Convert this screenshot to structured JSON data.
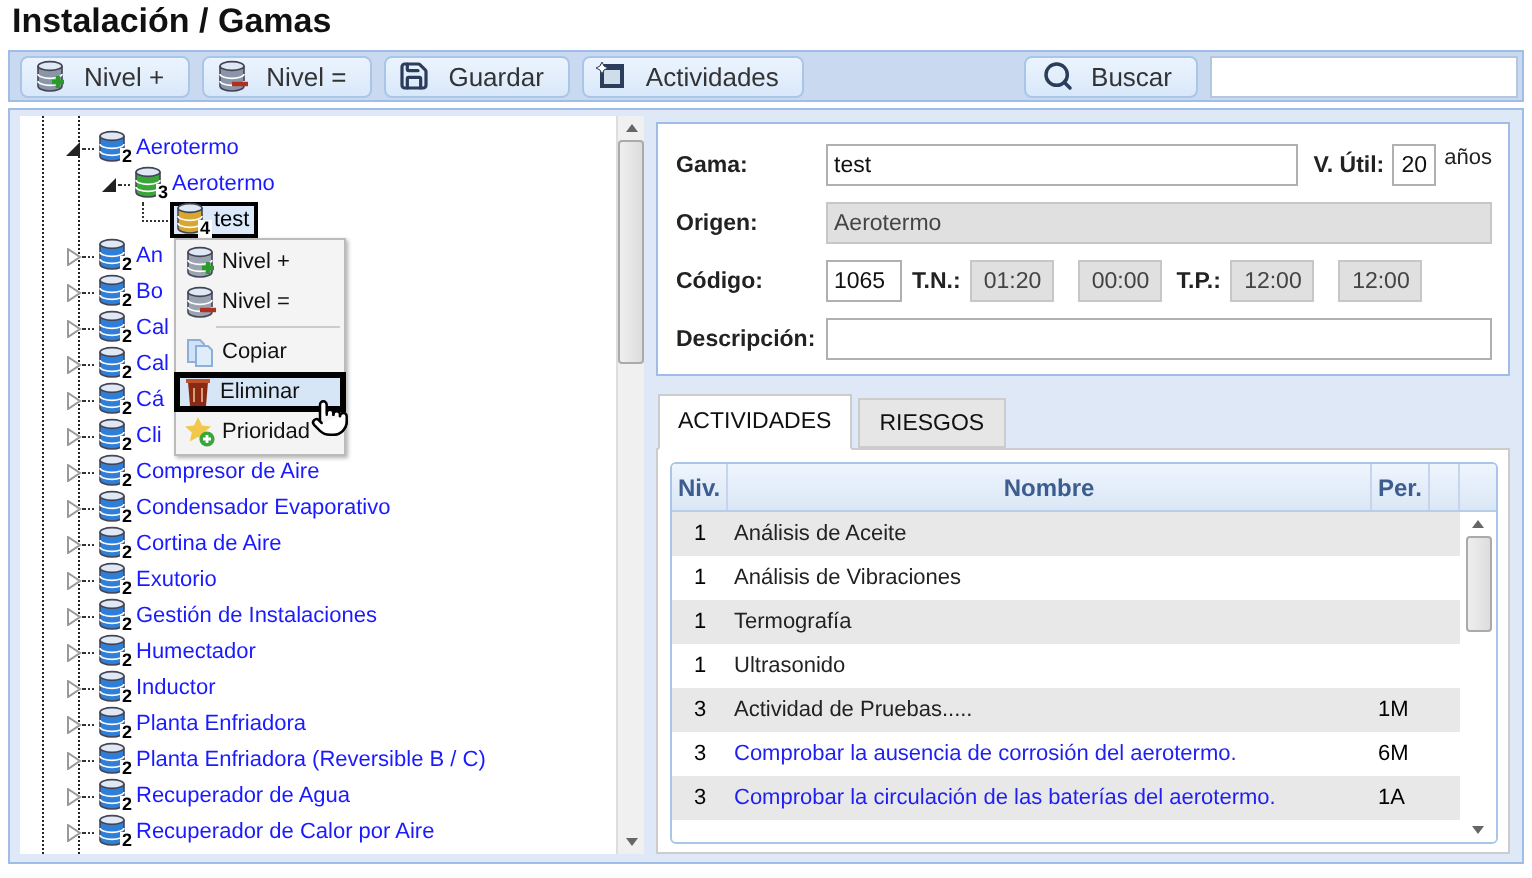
{
  "page_title": "Instalación / Gamas",
  "toolbar": {
    "buttons": [
      {
        "kind": "level-add",
        "label": "Nivel +"
      },
      {
        "kind": "level-equal",
        "label": "Nivel ="
      },
      {
        "kind": "save",
        "label": "Guardar"
      },
      {
        "kind": "activities",
        "label": "Actividades"
      }
    ],
    "search_button": "Buscar"
  },
  "tree": {
    "items": [
      {
        "label": "Aerotermo",
        "badge": "2",
        "color": "#2f7fd8",
        "expanded": true,
        "selected": false,
        "children": [
          {
            "label": "Aerotermo",
            "badge": "3",
            "color": "#3aa63a",
            "expanded": true,
            "selected": false,
            "children": [
              {
                "label": "test",
                "badge": "4",
                "color": "#d9a630",
                "selected": true
              }
            ]
          }
        ]
      },
      {
        "label": "An",
        "badge": "2",
        "color": "#2f7fd8",
        "expanded": false,
        "selected": false
      },
      {
        "label": "Bo",
        "badge": "2",
        "color": "#2f7fd8",
        "expanded": false,
        "selected": false
      },
      {
        "label": "Cal",
        "badge": "2",
        "color": "#2f7fd8",
        "expanded": false,
        "selected": false
      },
      {
        "label": "Cal",
        "badge": "2",
        "color": "#2f7fd8",
        "expanded": false,
        "selected": false
      },
      {
        "label": "Cá",
        "badge": "2",
        "color": "#2f7fd8",
        "expanded": false,
        "selected": false
      },
      {
        "label": "Cli",
        "badge": "2",
        "color": "#2f7fd8",
        "expanded": false,
        "selected": false
      },
      {
        "label": "Compresor de Aire",
        "badge": "2",
        "color": "#2f7fd8",
        "expanded": false,
        "selected": false
      },
      {
        "label": "Condensador Evaporativo",
        "badge": "2",
        "color": "#2f7fd8",
        "expanded": false,
        "selected": false
      },
      {
        "label": "Cortina de Aire",
        "badge": "2",
        "color": "#2f7fd8",
        "expanded": false,
        "selected": false
      },
      {
        "label": "Exutorio",
        "badge": "2",
        "color": "#2f7fd8",
        "expanded": false,
        "selected": false
      },
      {
        "label": "Gestión de Instalaciones",
        "badge": "2",
        "color": "#2f7fd8",
        "expanded": false,
        "selected": false
      },
      {
        "label": "Humectador",
        "badge": "2",
        "color": "#2f7fd8",
        "expanded": false,
        "selected": false
      },
      {
        "label": "Inductor",
        "badge": "2",
        "color": "#2f7fd8",
        "expanded": false,
        "selected": false
      },
      {
        "label": "Planta Enfriadora",
        "badge": "2",
        "color": "#2f7fd8",
        "expanded": false,
        "selected": false
      },
      {
        "label": "Planta Enfriadora (Reversible B / C)",
        "badge": "2",
        "color": "#2f7fd8",
        "expanded": false,
        "selected": false
      },
      {
        "label": "Recuperador de Agua",
        "badge": "2",
        "color": "#2f7fd8",
        "expanded": false,
        "selected": false
      },
      {
        "label": "Recuperador de Calor por Aire",
        "badge": "2",
        "color": "#2f7fd8",
        "expanded": false,
        "selected": false
      }
    ]
  },
  "context_menu": {
    "items": [
      {
        "kind": "level-add",
        "label": "Nivel +",
        "selected": false
      },
      {
        "kind": "level-equal",
        "label": "Nivel =",
        "selected": false
      },
      {
        "kind": "separator"
      },
      {
        "kind": "copy",
        "label": "Copiar",
        "selected": false
      },
      {
        "kind": "delete",
        "label": "Eliminar",
        "selected": true
      },
      {
        "kind": "priority",
        "label": "Prioridad",
        "selected": false
      }
    ]
  },
  "form": {
    "gama": {
      "label": "Gama:",
      "value": "test",
      "disabled": false
    },
    "vida_util": {
      "label": "V. Útil:",
      "value": "20",
      "unit": "años",
      "disabled": false
    },
    "origen": {
      "label": "Origen:",
      "value": "Aerotermo",
      "disabled": true
    },
    "codigo": {
      "label": "Código:",
      "value": "1065",
      "disabled": false
    },
    "tn": {
      "label": "T.N.:",
      "values": [
        "01:20",
        "00:00"
      ],
      "disabled": true
    },
    "tp": {
      "label": "T.P.:",
      "values": [
        "12:00",
        "12:00"
      ],
      "disabled": true
    },
    "descripcion": {
      "label": "Descripción:",
      "disabled": false
    }
  },
  "tabs": [
    {
      "label": "ACTIVIDADES",
      "selected": true
    },
    {
      "label": "RIESGOS",
      "selected": false
    }
  ],
  "grid": {
    "columns": [
      "Niv.",
      "Nombre",
      "Per."
    ],
    "rows": [
      {
        "niv": "1",
        "nombre": "Análisis de Aceite",
        "color": "#222222"
      },
      {
        "niv": "1",
        "nombre": "Análisis de Vibraciones",
        "color": "#222222"
      },
      {
        "niv": "1",
        "nombre": "Termografía",
        "color": "#222222"
      },
      {
        "niv": "1",
        "nombre": "Ultrasonido",
        "color": "#222222"
      },
      {
        "niv": "3",
        "nombre": "Actividad de Pruebas.....",
        "per": "1M",
        "color": "#222222"
      },
      {
        "niv": "3",
        "nombre": "Comprobar la ausencia de corrosión del aerotermo.",
        "per": "6M",
        "color": "#1f1fef"
      },
      {
        "niv": "3",
        "nombre": "Comprobar la circulación de las baterías del aerotermo.",
        "per": "1A",
        "color": "#1f1fef"
      }
    ]
  }
}
